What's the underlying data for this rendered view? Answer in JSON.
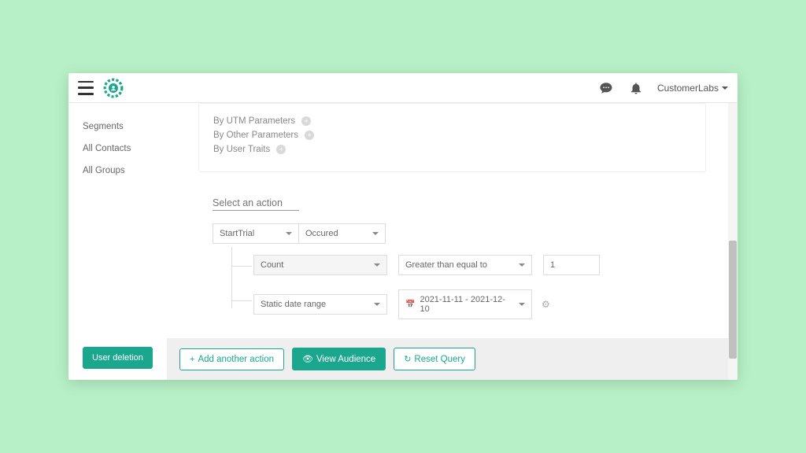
{
  "header": {
    "user_label": "CustomerLabs"
  },
  "sidebar": {
    "items": [
      {
        "label": "Segments"
      },
      {
        "label": "All Contacts"
      },
      {
        "label": "All Groups"
      }
    ],
    "user_deletion": "User deletion"
  },
  "filters": {
    "utm_label": "By UTM Parameters",
    "other_label": "By Other Parameters",
    "traits_label": "By User Traits"
  },
  "action": {
    "placeholder": "Select an action",
    "event": "StartTrial",
    "state": "Occured",
    "metric": "Count",
    "comparator": "Greater than equal to",
    "value": "1",
    "date_mode": "Static date range",
    "date_range": "2021-11-11 - 2021-12-10"
  },
  "footer": {
    "add_action": "Add another action",
    "view_audience": "View Audience",
    "reset_query": "Reset Query"
  }
}
